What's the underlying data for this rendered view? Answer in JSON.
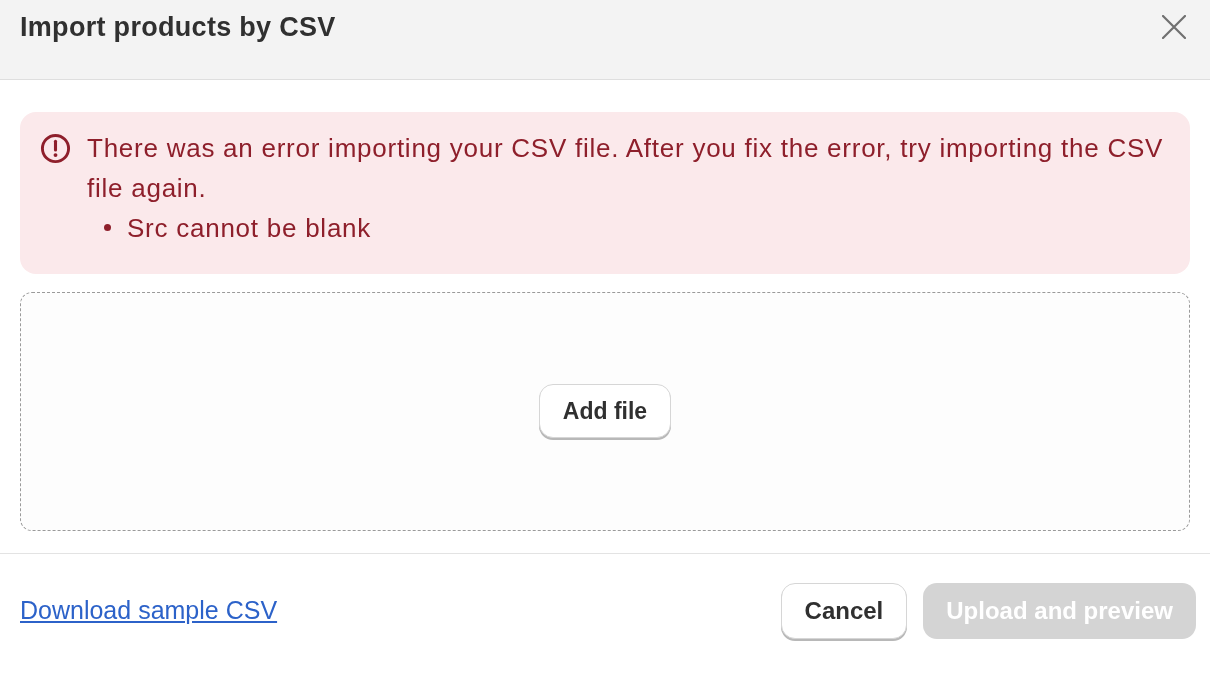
{
  "dialog": {
    "title": "Import products by CSV"
  },
  "error_banner": {
    "message": "There was an error importing your CSV file. After you fix the error, try importing the CSV file again.",
    "errors": [
      "Src cannot be blank"
    ]
  },
  "drop_zone": {
    "button": "Add file"
  },
  "footer": {
    "link": "Download sample CSV",
    "buttons": [
      {
        "label": "Cancel",
        "kind": "secondary",
        "disabled": false
      },
      {
        "label": "Upload and preview",
        "kind": "primary",
        "disabled": true
      }
    ]
  }
}
